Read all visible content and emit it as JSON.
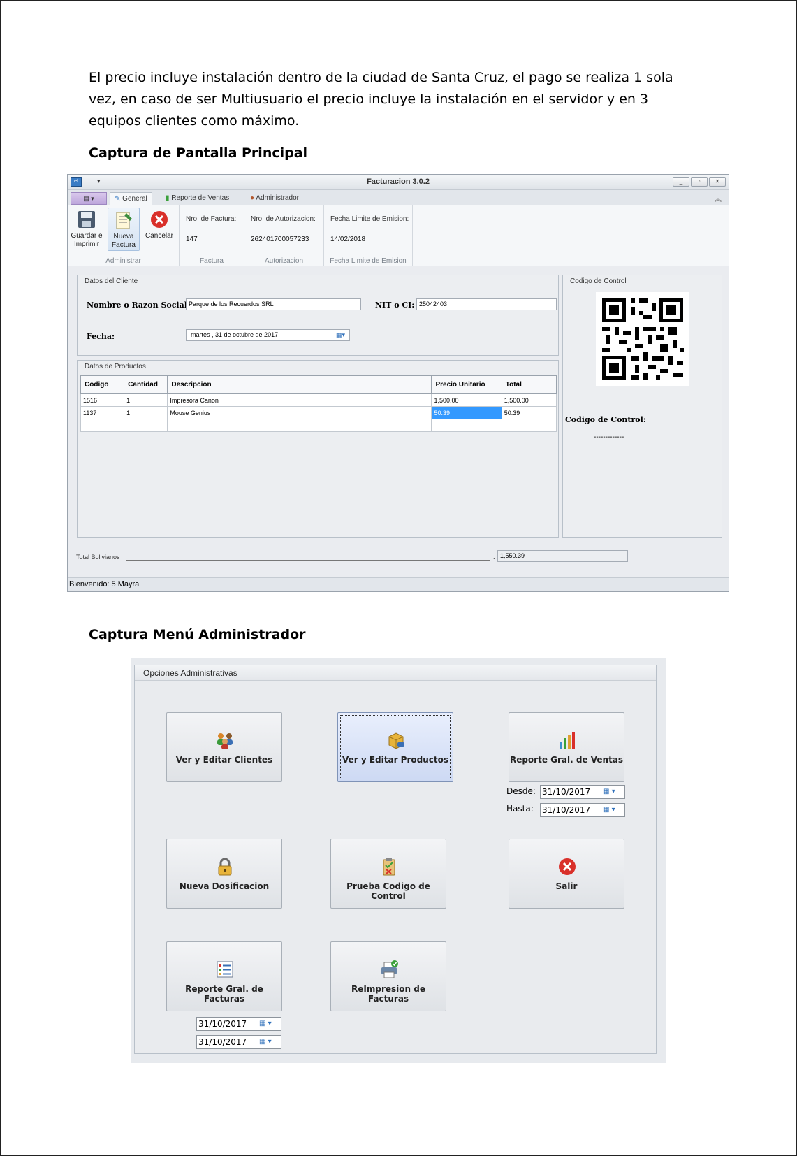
{
  "intro_text": "El precio incluye instalación dentro de la ciudad de Santa Cruz, el pago se realiza 1 sola vez, en caso de ser Multiusuario el precio incluye la instalación en el servidor y en 3 equipos clientes como máximo.",
  "heading_main": "Captura de Pantalla Principal",
  "heading_admin": "Captura Menú Administrador",
  "main_window": {
    "title": "Facturacion 3.0.2",
    "tabs": [
      "General",
      "Reporte de Ventas",
      "Administrador"
    ],
    "ribbon": {
      "buttons": [
        {
          "label": "Guardar e Imprimir",
          "icon": "floppy-disk-icon"
        },
        {
          "label": "Nueva Factura",
          "icon": "new-document-icon"
        },
        {
          "label": "Cancelar",
          "icon": "cancel-icon"
        }
      ],
      "group_administrar": "Administrar",
      "nro_factura_label": "Nro. de Factura:",
      "nro_factura_value": "147",
      "group_factura": "Factura",
      "nro_autorizacion_label": "Nro. de Autorizacion:",
      "nro_autorizacion_value": "262401700057233",
      "group_autorizacion": "Autorizacion",
      "fecha_limite_label": "Fecha Limite de Emision:",
      "fecha_limite_value": "14/02/2018",
      "group_fecha_limite": "Fecha Limite de Emision"
    },
    "cliente": {
      "panel_title": "Datos del Cliente",
      "razon_label": "Nombre o Razon Social:",
      "razon_value": "Parque de los Recuerdos SRL",
      "nit_label": "NIT o CI:",
      "nit_value": "25042403",
      "fecha_label": "Fecha:",
      "fecha_value": "martes , 31 de  octubre  de 2017"
    },
    "productos": {
      "panel_title": "Datos de Productos",
      "columns": [
        "Codigo",
        "Cantidad",
        "Descripcion",
        "Precio Unitario",
        "Total"
      ],
      "rows": [
        [
          "1516",
          "1",
          "Impresora Canon",
          "1,500.00",
          "1,500.00"
        ],
        [
          "1137",
          "1",
          "Mouse Genius",
          "50.39",
          "50.39"
        ]
      ]
    },
    "control": {
      "panel_title": "Codigo de Control",
      "label": "Codigo de Control:",
      "value": "-------------"
    },
    "total_label": "Total Bolivianos",
    "total_value": "1,550.39",
    "status": "Bienvenido:  5  Mayra"
  },
  "admin_menu": {
    "group_title": "Opciones Administrativas",
    "buttons": {
      "clientes": "Ver y Editar Clientes",
      "productos": "Ver y Editar Productos",
      "reporte_ventas": "Reporte Gral. de Ventas",
      "dosificacion": "Nueva Dosificacion",
      "prueba_codigo": "Prueba Codigo de Control",
      "salir": "Salir",
      "reporte_facturas": "Reporte Gral. de Facturas",
      "reimpresion": "ReImpresion de Facturas"
    },
    "desde_label": "Desde:",
    "hasta_label": "Hasta:",
    "ventas_desde": "31/10/2017",
    "ventas_hasta": "31/10/2017",
    "facturas_desde": "31/10/2017",
    "facturas_hasta": "31/10/2017"
  }
}
